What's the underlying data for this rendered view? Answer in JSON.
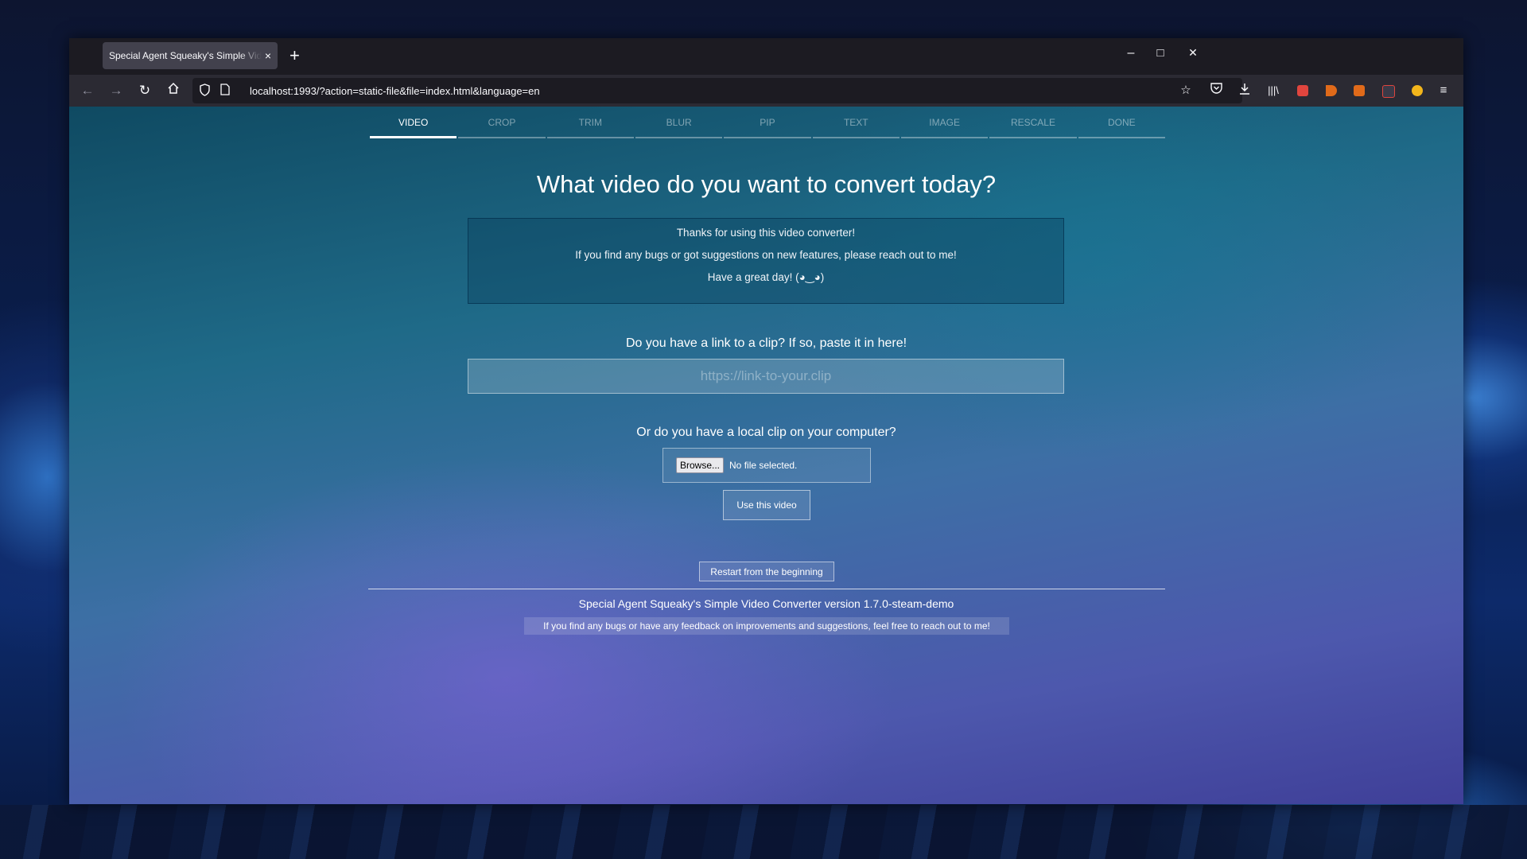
{
  "browser": {
    "tab_title": "Special Agent Squeaky's Simple Video Converter",
    "tab_close": "×",
    "new_tab": "+",
    "url": "localhost:1993/?action=static-file&file=index.html&language=en",
    "window_controls": {
      "minimize": "–",
      "maximize": "□",
      "close": "✕"
    },
    "nav_icons": [
      "back-icon",
      "forward-icon",
      "reload-icon",
      "home-icon",
      "shield-icon",
      "page-icon",
      "bookmark-star-icon",
      "pocket-icon",
      "download-icon",
      "library-icon",
      "extension-icons",
      "menu-icon"
    ]
  },
  "steps": {
    "items": [
      {
        "label": "VIDEO",
        "active": true
      },
      {
        "label": "CROP",
        "active": false
      },
      {
        "label": "TRIM",
        "active": false
      },
      {
        "label": "BLUR",
        "active": false
      },
      {
        "label": "PIP",
        "active": false
      },
      {
        "label": "TEXT",
        "active": false
      },
      {
        "label": "IMAGE",
        "active": false
      },
      {
        "label": "RESCALE",
        "active": false
      },
      {
        "label": "DONE",
        "active": false
      }
    ]
  },
  "main": {
    "headline": "What video do you want to convert today?",
    "info": {
      "line1": "Thanks for using this video converter!",
      "line2": "If you find any bugs or got suggestions on new features, please reach out to me!",
      "line3": "Have a great day! (◕‿◕)"
    },
    "link_question": "Do you have a link to a clip? If so, paste it in here!",
    "link_placeholder": "https://link-to-your.clip",
    "local_question": "Or do you have a local clip on your computer?",
    "browse_label": "Browse...",
    "file_status": "No file selected.",
    "use_button": "Use this video",
    "restart_button": "Restart from the beginning"
  },
  "footer": {
    "version": "Special Agent Squeaky's Simple Video Converter version 1.7.0-steam-demo",
    "feedback": "If you find any bugs or have any feedback on improvements and suggestions, feel free to reach out to me!"
  },
  "colors": {
    "active_step": "#ffffff",
    "inactive_step": "rgba(255,255,255,0.45)",
    "browser_chrome": "#2b2a33",
    "ext_red": "#e0453e",
    "ext_orange": "#e06a1a",
    "ext_yellow": "#f2b51b"
  }
}
